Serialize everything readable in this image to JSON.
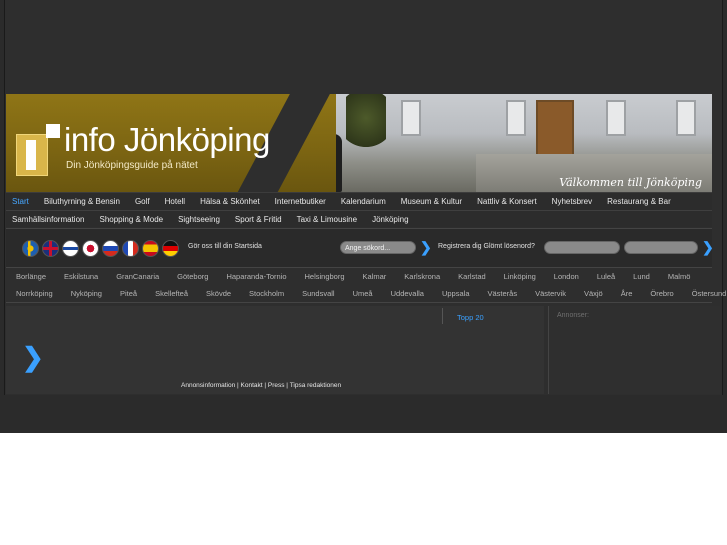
{
  "brand": {
    "title": "info Jönköping",
    "subtitle": "Din Jönköpingsguide på nätet",
    "welcome": "Välkommen till Jönköping",
    "accent_color": "#47a7ff",
    "background_color": "#2b2b2b"
  },
  "nav": {
    "row1": [
      "Start",
      "Biluthyrning & Bensin",
      "Golf",
      "Hotell",
      "Hälsa & Skönhet",
      "Internetbutiker",
      "Kalendarium",
      "Museum & Kultur",
      "Nattliv & Konsert",
      "Nyhetsbrev",
      "Restaurang & Bar"
    ],
    "row2": [
      "Samhällsinformation",
      "Shopping & Mode",
      "Sightseeing",
      "Sport & Fritid",
      "Taxi & Limousine",
      "Jönköping"
    ],
    "active": "Start"
  },
  "toolbar": {
    "flags": [
      "sweden-flag-icon",
      "uk-flag-icon",
      "finland-flag-icon",
      "japan-flag-icon",
      "russia-flag-icon",
      "france-flag-icon",
      "spain-flag-icon",
      "germany-flag-icon"
    ],
    "goto_start": "Gör oss till din Startsida",
    "search_placeholder": "Ange sökord...",
    "register_text": "Registrera dig  Glömt lösenord?"
  },
  "cities": {
    "row1": [
      "Borlänge",
      "Eskilstuna",
      "GranCanaria",
      "Göteborg",
      "Haparanda-Tornio",
      "Helsingborg",
      "Kalmar",
      "Karlskrona",
      "Karlstad",
      "Linköping",
      "London",
      "Luleå",
      "Lund",
      "Malmö"
    ],
    "row2": [
      "Norrköping",
      "Nyköping",
      "Piteå",
      "Skellefteå",
      "Skövde",
      "Stockholm",
      "Sundsvall",
      "Umeå",
      "Uddevalla",
      "Uppsala",
      "Västerås",
      "Västervik",
      "Växjö",
      "Åre",
      "Örebro",
      "Östersund"
    ]
  },
  "content": {
    "topp20": "Topp 20",
    "footer_links": [
      "Annonsinformation",
      "Kontakt",
      "Press",
      "Tipsa redaktionen"
    ],
    "footer_separator": " | "
  },
  "ads": {
    "label": "Annonser:"
  }
}
